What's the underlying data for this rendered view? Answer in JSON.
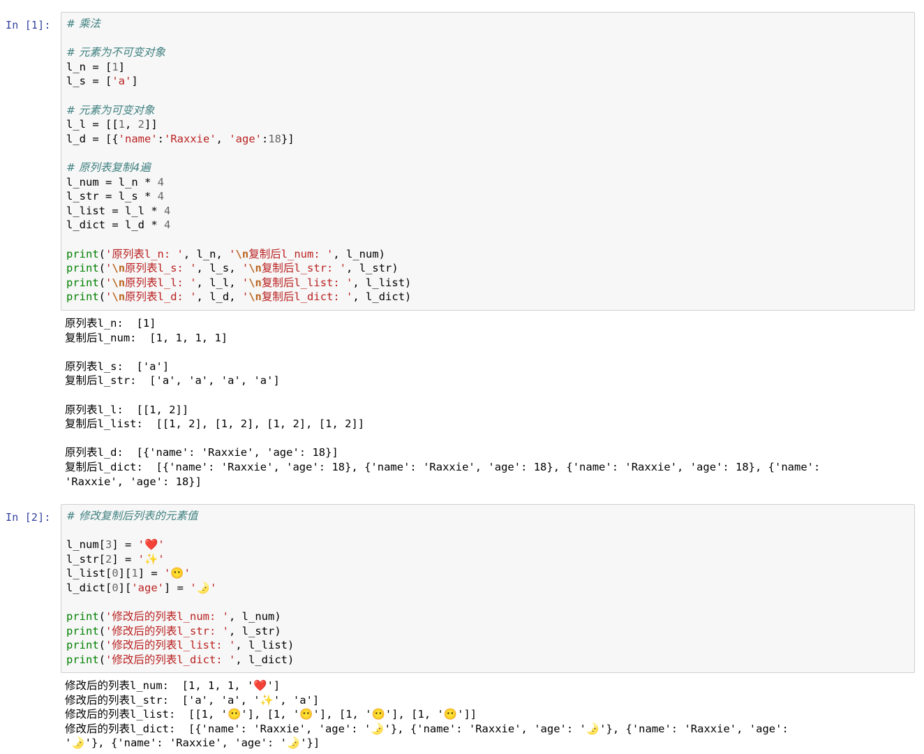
{
  "cells": [
    {
      "prompt": "In [1]:",
      "code_lines": [
        [
          {
            "t": "# 乘法",
            "c": "cm"
          }
        ],
        [],
        [
          {
            "t": "# 元素为不可变对象",
            "c": "cm"
          }
        ],
        [
          {
            "t": "l_n = [",
            "c": "op"
          },
          {
            "t": "1",
            "c": "nu"
          },
          {
            "t": "]",
            "c": "op"
          }
        ],
        [
          {
            "t": "l_s = [",
            "c": "op"
          },
          {
            "t": "'a'",
            "c": "st"
          },
          {
            "t": "]",
            "c": "op"
          }
        ],
        [],
        [
          {
            "t": "# 元素为可变对象",
            "c": "cm"
          }
        ],
        [
          {
            "t": "l_l = [[",
            "c": "op"
          },
          {
            "t": "1",
            "c": "nu"
          },
          {
            "t": ", ",
            "c": "op"
          },
          {
            "t": "2",
            "c": "nu"
          },
          {
            "t": "]]",
            "c": "op"
          }
        ],
        [
          {
            "t": "l_d = [{",
            "c": "op"
          },
          {
            "t": "'name'",
            "c": "st"
          },
          {
            "t": ":",
            "c": "op"
          },
          {
            "t": "'Raxxie'",
            "c": "st"
          },
          {
            "t": ", ",
            "c": "op"
          },
          {
            "t": "'age'",
            "c": "st"
          },
          {
            "t": ":",
            "c": "op"
          },
          {
            "t": "18",
            "c": "nu"
          },
          {
            "t": "}]",
            "c": "op"
          }
        ],
        [],
        [
          {
            "t": "# 原列表复制4遍",
            "c": "cm"
          }
        ],
        [
          {
            "t": "l_num = l_n * ",
            "c": "op"
          },
          {
            "t": "4",
            "c": "nu"
          }
        ],
        [
          {
            "t": "l_str = l_s * ",
            "c": "op"
          },
          {
            "t": "4",
            "c": "nu"
          }
        ],
        [
          {
            "t": "l_list = l_l * ",
            "c": "op"
          },
          {
            "t": "4",
            "c": "nu"
          }
        ],
        [
          {
            "t": "l_dict = l_d * ",
            "c": "op"
          },
          {
            "t": "4",
            "c": "nu"
          }
        ],
        [],
        [
          {
            "t": "print",
            "c": "kw"
          },
          {
            "t": "(",
            "c": "op"
          },
          {
            "t": "'原列表l_n: '",
            "c": "st"
          },
          {
            "t": ", l_n, ",
            "c": "op"
          },
          {
            "t": "'",
            "c": "st"
          },
          {
            "t": "\\n",
            "c": "es"
          },
          {
            "t": "复制后l_num: '",
            "c": "st"
          },
          {
            "t": ", l_num)",
            "c": "op"
          }
        ],
        [
          {
            "t": "print",
            "c": "kw"
          },
          {
            "t": "(",
            "c": "op"
          },
          {
            "t": "'",
            "c": "st"
          },
          {
            "t": "\\n",
            "c": "es"
          },
          {
            "t": "原列表l_s: '",
            "c": "st"
          },
          {
            "t": ", l_s, ",
            "c": "op"
          },
          {
            "t": "'",
            "c": "st"
          },
          {
            "t": "\\n",
            "c": "es"
          },
          {
            "t": "复制后l_str: '",
            "c": "st"
          },
          {
            "t": ", l_str)",
            "c": "op"
          }
        ],
        [
          {
            "t": "print",
            "c": "kw"
          },
          {
            "t": "(",
            "c": "op"
          },
          {
            "t": "'",
            "c": "st"
          },
          {
            "t": "\\n",
            "c": "es"
          },
          {
            "t": "原列表l_l: '",
            "c": "st"
          },
          {
            "t": ", l_l, ",
            "c": "op"
          },
          {
            "t": "'",
            "c": "st"
          },
          {
            "t": "\\n",
            "c": "es"
          },
          {
            "t": "复制后l_list: '",
            "c": "st"
          },
          {
            "t": ", l_list)",
            "c": "op"
          }
        ],
        [
          {
            "t": "print",
            "c": "kw"
          },
          {
            "t": "(",
            "c": "op"
          },
          {
            "t": "'",
            "c": "st"
          },
          {
            "t": "\\n",
            "c": "es"
          },
          {
            "t": "原列表l_d: '",
            "c": "st"
          },
          {
            "t": ", l_d, ",
            "c": "op"
          },
          {
            "t": "'",
            "c": "st"
          },
          {
            "t": "\\n",
            "c": "es"
          },
          {
            "t": "复制后l_dict: '",
            "c": "st"
          },
          {
            "t": ", l_dict)",
            "c": "op"
          }
        ]
      ],
      "output_lines": [
        "原列表l_n:  [1]",
        "复制后l_num:  [1, 1, 1, 1]",
        "",
        "原列表l_s:  ['a']",
        "复制后l_str:  ['a', 'a', 'a', 'a']",
        "",
        "原列表l_l:  [[1, 2]]",
        "复制后l_list:  [[1, 2], [1, 2], [1, 2], [1, 2]]",
        "",
        "原列表l_d:  [{'name': 'Raxxie', 'age': 18}]",
        "复制后l_dict:  [{'name': 'Raxxie', 'age': 18}, {'name': 'Raxxie', 'age': 18}, {'name': 'Raxxie', 'age': 18}, {'name':",
        "'Raxxie', 'age': 18}]"
      ]
    },
    {
      "prompt": "In [2]:",
      "code_lines": [
        [
          {
            "t": "# 修改复制后列表的元素值",
            "c": "cm"
          }
        ],
        [],
        [
          {
            "t": "l_num[",
            "c": "op"
          },
          {
            "t": "3",
            "c": "nu"
          },
          {
            "t": "] = ",
            "c": "op"
          },
          {
            "t": "'",
            "c": "st"
          },
          {
            "t": "❤️",
            "c": "emoji-heart"
          },
          {
            "t": "'",
            "c": "st"
          }
        ],
        [
          {
            "t": "l_str[",
            "c": "op"
          },
          {
            "t": "2",
            "c": "nu"
          },
          {
            "t": "] = ",
            "c": "op"
          },
          {
            "t": "'",
            "c": "st"
          },
          {
            "t": "✨",
            "c": "emoji-spark"
          },
          {
            "t": "'",
            "c": "st"
          }
        ],
        [
          {
            "t": "l_list[",
            "c": "op"
          },
          {
            "t": "0",
            "c": "nu"
          },
          {
            "t": "][",
            "c": "op"
          },
          {
            "t": "1",
            "c": "nu"
          },
          {
            "t": "] = ",
            "c": "op"
          },
          {
            "t": "'",
            "c": "st"
          },
          {
            "t": "😶",
            "c": "emoji-face"
          },
          {
            "t": "'",
            "c": "st"
          }
        ],
        [
          {
            "t": "l_dict[",
            "c": "op"
          },
          {
            "t": "0",
            "c": "nu"
          },
          {
            "t": "][",
            "c": "op"
          },
          {
            "t": "'age'",
            "c": "st"
          },
          {
            "t": "] = ",
            "c": "op"
          },
          {
            "t": "'",
            "c": "st"
          },
          {
            "t": "🌛",
            "c": "emoji-moon"
          },
          {
            "t": "'",
            "c": "st"
          }
        ],
        [],
        [
          {
            "t": "print",
            "c": "kw"
          },
          {
            "t": "(",
            "c": "op"
          },
          {
            "t": "'修改后的列表l_num: '",
            "c": "st"
          },
          {
            "t": ", l_num)",
            "c": "op"
          }
        ],
        [
          {
            "t": "print",
            "c": "kw"
          },
          {
            "t": "(",
            "c": "op"
          },
          {
            "t": "'修改后的列表l_str: '",
            "c": "st"
          },
          {
            "t": ", l_str)",
            "c": "op"
          }
        ],
        [
          {
            "t": "print",
            "c": "kw"
          },
          {
            "t": "(",
            "c": "op"
          },
          {
            "t": "'修改后的列表l_list: '",
            "c": "st"
          },
          {
            "t": ", l_list)",
            "c": "op"
          }
        ],
        [
          {
            "t": "print",
            "c": "kw"
          },
          {
            "t": "(",
            "c": "op"
          },
          {
            "t": "'修改后的列表l_dict: '",
            "c": "st"
          },
          {
            "t": ", l_dict)",
            "c": "op"
          }
        ]
      ],
      "output_lines": [
        "修改后的列表l_num:  [1, 1, 1, '❤️']",
        "修改后的列表l_str:  ['a', 'a', '✨', 'a']",
        "修改后的列表l_list:  [[1, '😶'], [1, '😶'], [1, '😶'], [1, '😶']]",
        "修改后的列表l_dict:  [{'name': 'Raxxie', 'age': '🌛'}, {'name': 'Raxxie', 'age': '🌛'}, {'name': 'Raxxie', 'age':",
        "'🌛'}, {'name': 'Raxxie', 'age': '🌛'}]"
      ]
    }
  ]
}
